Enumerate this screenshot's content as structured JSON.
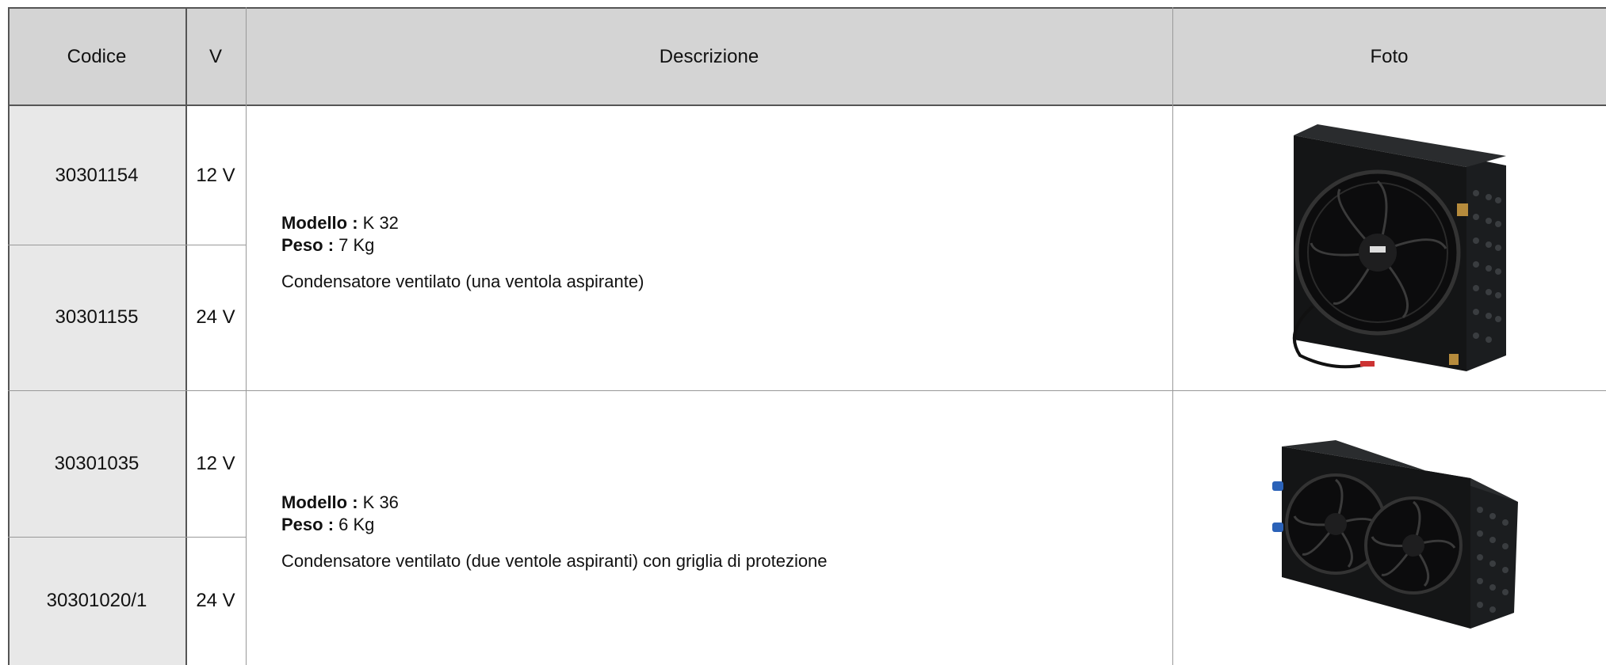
{
  "table": {
    "headers": {
      "code": "Codice",
      "voltage": "V",
      "description": "Descrizione",
      "photo": "Foto"
    },
    "groups": [
      {
        "rows": [
          {
            "code": "30301154",
            "voltage": "12 V"
          },
          {
            "code": "30301155",
            "voltage": "24 V"
          }
        ],
        "model_label": "Modello :",
        "model_value": " K 32",
        "weight_label": "Peso :",
        "weight_value": " 7 Kg",
        "text": "Condensatore ventilato (una ventola aspirante)",
        "photo_icon": "single-fan-condenser"
      },
      {
        "rows": [
          {
            "code": "30301035",
            "voltage": "12 V"
          },
          {
            "code": "30301020/1",
            "voltage": "24 V"
          }
        ],
        "model_label": "Modello :",
        "model_value": " K 36",
        "weight_label": "Peso :",
        "weight_value": " 6 Kg",
        "text": "Condensatore ventilato (due ventole aspiranti) con griglia di protezione",
        "photo_icon": "double-fan-condenser"
      }
    ]
  }
}
